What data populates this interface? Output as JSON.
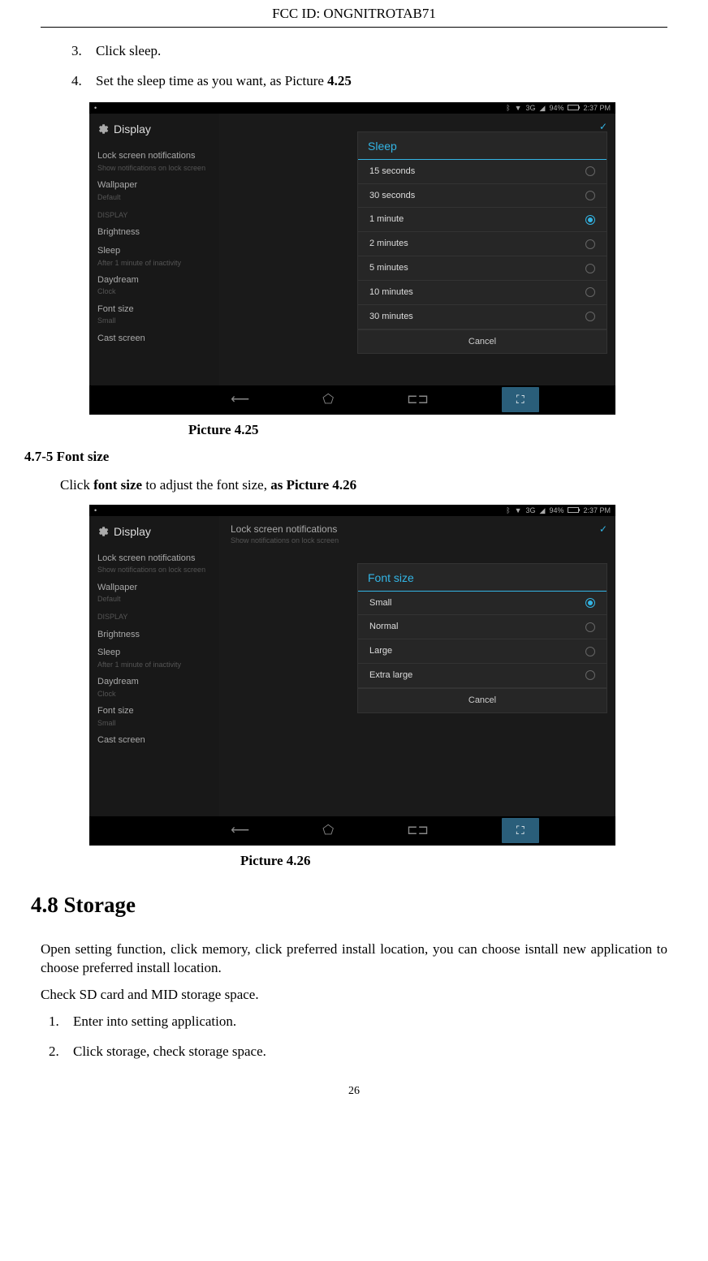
{
  "header": {
    "fcc": "FCC ID:  ONGNITROTAB71"
  },
  "steps_top": [
    {
      "num": "3.",
      "text": "Click sleep."
    },
    {
      "num": "4.",
      "text_prefix": "Set the sleep time as you want, as Picture ",
      "text_bold": "4.25"
    }
  ],
  "statusbar": {
    "left": "•",
    "right_sig": "3G",
    "right_batt": "94%",
    "right_time": "2:37 PM"
  },
  "display_settings": {
    "title": "Display",
    "lock_notif": "Lock screen notifications",
    "lock_sub": "Show notifications on lock screen",
    "sidebar": [
      {
        "main": "Wallpaper",
        "sub": "Default"
      },
      {
        "main": "DISPLAY",
        "header": true
      },
      {
        "main": "Brightness"
      },
      {
        "main": "Sleep",
        "sub": "After 1 minute of inactivity"
      },
      {
        "main": "Daydream",
        "sub": "Clock"
      },
      {
        "main": "Font size",
        "sub": "Small"
      },
      {
        "main": "Cast screen"
      }
    ]
  },
  "sleep_dialog": {
    "title": "Sleep",
    "options": [
      {
        "label": "15 seconds",
        "selected": false
      },
      {
        "label": "30 seconds",
        "selected": false
      },
      {
        "label": "1 minute",
        "selected": true
      },
      {
        "label": "2 minutes",
        "selected": false
      },
      {
        "label": "5 minutes",
        "selected": false
      },
      {
        "label": "10 minutes",
        "selected": false
      },
      {
        "label": "30 minutes",
        "selected": false
      }
    ],
    "cancel": "Cancel"
  },
  "caption1": "Picture 4.25",
  "section2": {
    "heading": "4.7-5 Font size",
    "text_prefix": "Click ",
    "text_bold1": "font size",
    "text_mid": " to adjust the font size, ",
    "text_bold2": "as Picture 4.26"
  },
  "font_dialog": {
    "title": "Font size",
    "options": [
      {
        "label": "Small",
        "selected": true
      },
      {
        "label": "Normal",
        "selected": false
      },
      {
        "label": "Large",
        "selected": false
      },
      {
        "label": "Extra large",
        "selected": false
      }
    ],
    "cancel": "Cancel"
  },
  "caption2": "Picture 4.26",
  "storage": {
    "heading": "4.8 Storage",
    "para1": "Open setting function, click memory, click preferred install location, you can choose isntall new application to choose preferred install location.",
    "para2": "Check SD card and MID storage space.",
    "steps": [
      {
        "num": "1.",
        "text": "Enter into setting application."
      },
      {
        "num": "2.",
        "text": "Click storage, check storage space."
      }
    ]
  },
  "pagenum": "26",
  "icons": {
    "bt": "ᛒ",
    "wifi": "▾"
  }
}
